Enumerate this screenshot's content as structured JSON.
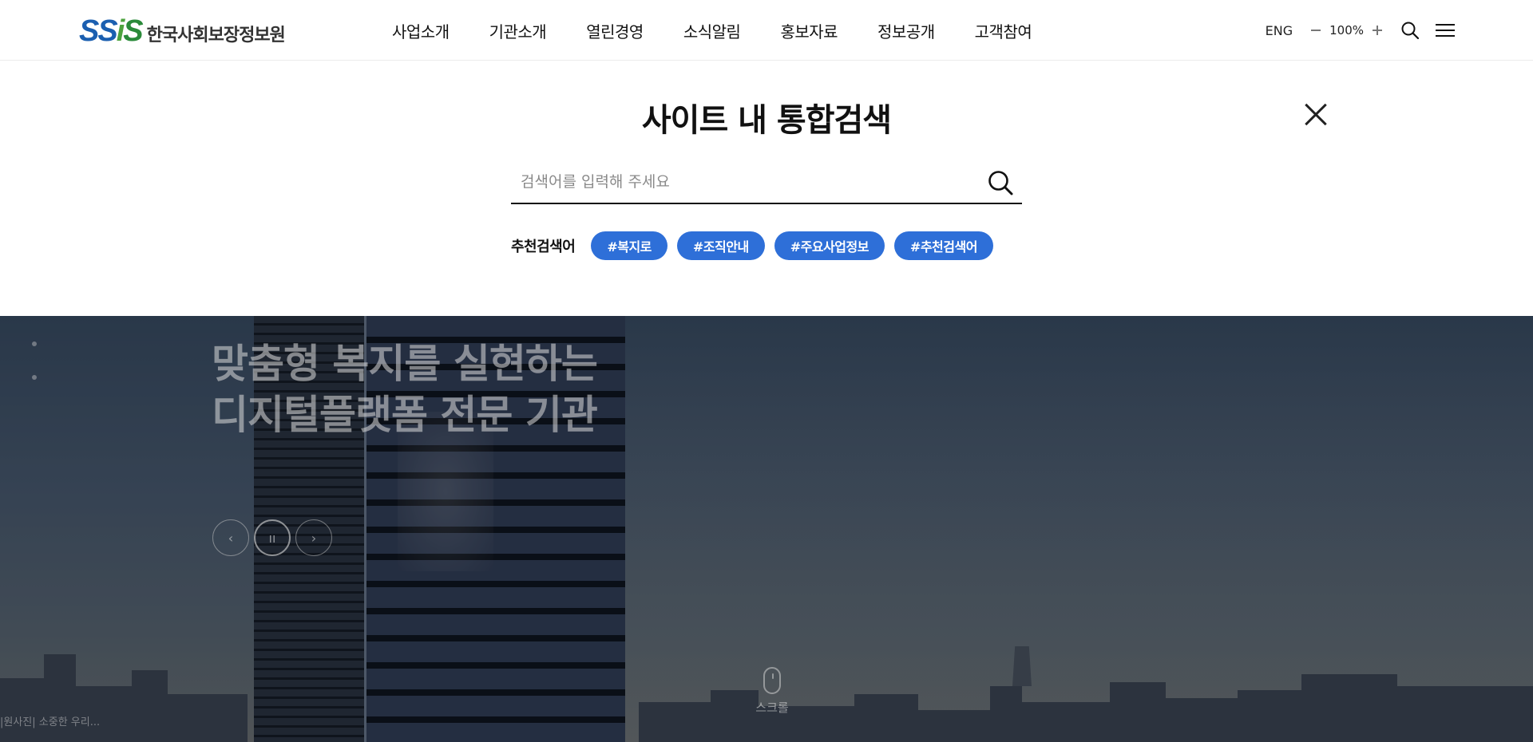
{
  "header": {
    "logo_mark": [
      "S",
      "S",
      "i",
      "S"
    ],
    "logo_text": "한국사회보장정보원",
    "nav": [
      "사업소개",
      "기관소개",
      "열린경영",
      "소식알림",
      "홍보자료",
      "정보공개",
      "고객참여"
    ],
    "lang": "ENG",
    "zoom_value": "100%"
  },
  "search": {
    "title": "사이트 내 통합검색",
    "placeholder": "검색어를 입력해 주세요",
    "value": "",
    "recommend_label": "추천검색어",
    "tags": [
      "#복지로",
      "#조직안내",
      "#주요사업정보",
      "#추천검색어"
    ]
  },
  "hero": {
    "title_line1": "맞춤형 복지를 실현하는",
    "title_line2": "디지털플랫폼 전문 기관",
    "prev_glyph": "‹",
    "pause_glyph": "ıı",
    "next_glyph": "›",
    "scroll_label": "스크롤",
    "caption": "|원사진| 소중한 우리..."
  },
  "colors": {
    "tag_bg": "#2e6fd8",
    "logo_blue": "#1b5fb0",
    "logo_green": "#4da33e"
  }
}
